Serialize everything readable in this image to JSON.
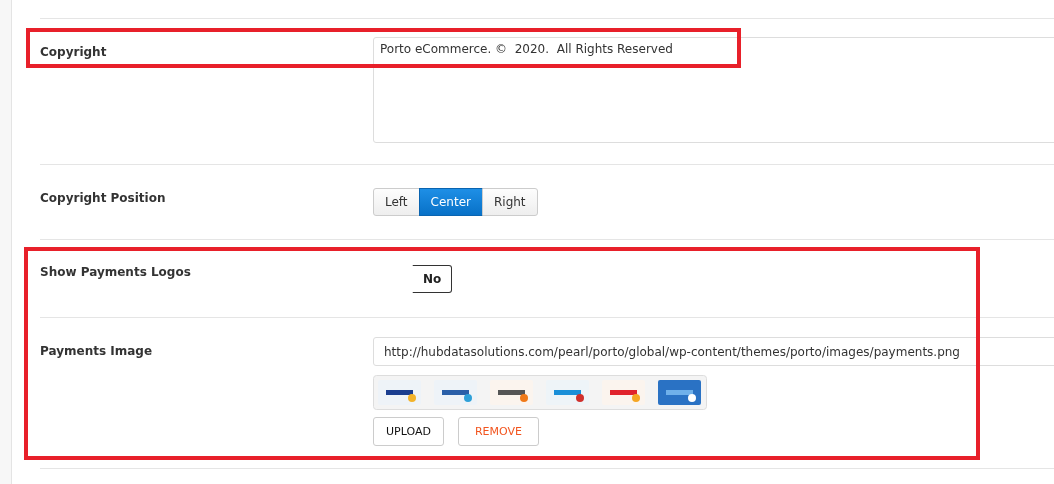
{
  "copyright": {
    "label": "Copyright",
    "value": "Porto eCommerce. ©  2020.  All Rights Reserved"
  },
  "copyright_position": {
    "label": "Copyright Position",
    "options": [
      {
        "label": "Left",
        "selected": false
      },
      {
        "label": "Center",
        "selected": true
      },
      {
        "label": "Right",
        "selected": false
      }
    ]
  },
  "show_payments_logos": {
    "label": "Show Payments Logos",
    "value": "No"
  },
  "payments_image": {
    "label": "Payments Image",
    "value": "http://hubdatasolutions.com/pearl/porto/global/wp-content/themes/porto/images/payments.png",
    "buttons": [
      {
        "label": "UPLOAD",
        "kind": "upload"
      },
      {
        "label": "REMOVE",
        "kind": "remove"
      }
    ]
  }
}
